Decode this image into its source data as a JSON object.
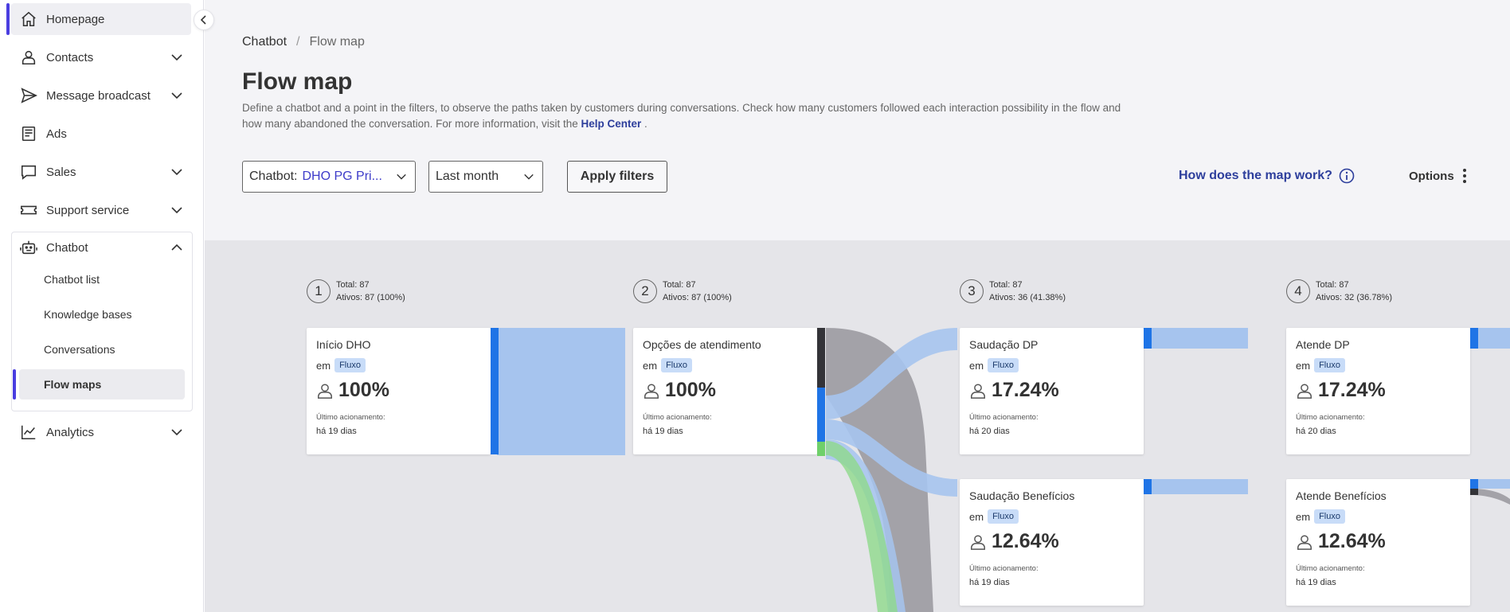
{
  "sidebar": {
    "items": [
      {
        "label": "Homepage"
      },
      {
        "label": "Contacts"
      },
      {
        "label": "Message broadcast"
      },
      {
        "label": "Ads"
      },
      {
        "label": "Sales"
      },
      {
        "label": "Support service"
      },
      {
        "label": "Chatbot"
      },
      {
        "label": "Analytics"
      }
    ],
    "chatbot_sub": [
      {
        "label": "Chatbot list"
      },
      {
        "label": "Knowledge bases"
      },
      {
        "label": "Conversations"
      },
      {
        "label": "Flow maps"
      }
    ]
  },
  "breadcrumb": {
    "parent": "Chatbot",
    "separator": "/",
    "current": "Flow map"
  },
  "page": {
    "title": "Flow map",
    "description": "Define a chatbot and a point in the filters, to observe the paths taken by customers during conversations. Check how many customers followed each interaction possibility in the flow and how many abandoned the conversation. For more information, visit the",
    "help_link": "Help Center",
    "description_end": "."
  },
  "filters": {
    "chatbot_label": "Chatbot:",
    "chatbot_value": "DHO PG Pri...",
    "period_value": "Last month",
    "apply_label": "Apply filters"
  },
  "help": {
    "how_label": "How does the map work?"
  },
  "options": {
    "label": "Options"
  },
  "stages": [
    {
      "num": "1",
      "total": "Total: 87",
      "active": "Ativos: 87 (100%)"
    },
    {
      "num": "2",
      "total": "Total: 87",
      "active": "Ativos: 87 (100%)"
    },
    {
      "num": "3",
      "total": "Total: 87",
      "active": "Ativos: 36 (41.38%)"
    },
    {
      "num": "4",
      "total": "Total: 87",
      "active": "Ativos: 32 (36.78%)"
    }
  ],
  "cards": [
    {
      "title": "Início DHO",
      "in": "em",
      "badge": "Fluxo",
      "pct": "100%",
      "last_label": "Último acionamento:",
      "last_value": "há 19 dias"
    },
    {
      "title": "Opções de atendimento",
      "in": "em",
      "badge": "Fluxo",
      "pct": "100%",
      "last_label": "Último acionamento:",
      "last_value": "há 19 dias"
    },
    {
      "title": "Saudação DP",
      "in": "em",
      "badge": "Fluxo",
      "pct": "17.24%",
      "last_label": "Último acionamento:",
      "last_value": "há 20 dias"
    },
    {
      "title": "Atende DP",
      "in": "em",
      "badge": "Fluxo",
      "pct": "17.24%",
      "last_label": "Último acionamento:",
      "last_value": "há 20 dias"
    },
    {
      "title": "Saudação Benefícios",
      "in": "em",
      "badge": "Fluxo",
      "pct": "12.64%",
      "last_label": "Último acionamento:",
      "last_value": "há 19 dias"
    },
    {
      "title": "Atende Benefícios",
      "in": "em",
      "badge": "Fluxo",
      "pct": "12.64%",
      "last_label": "Último acionamento:",
      "last_value": "há 19 dias"
    }
  ],
  "colors": {
    "accent": "#4a3ee0",
    "link": "#2d3e9c",
    "port_blue": "#1f74e6",
    "flow_blue": "#a6c4ee",
    "flow_grey": "#a3a2a8",
    "flow_green": "#8fd98b",
    "port_dark": "#333338"
  }
}
